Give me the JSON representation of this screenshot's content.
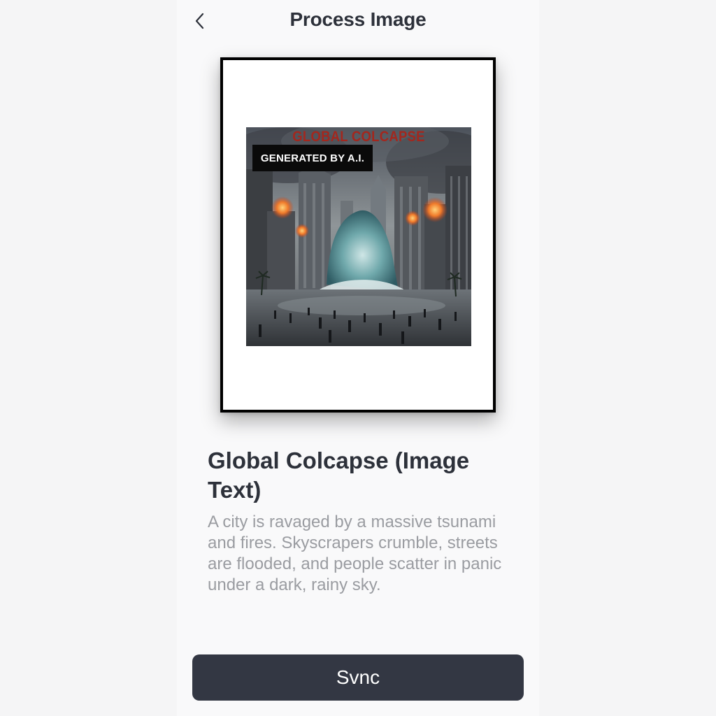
{
  "header": {
    "title": "Process Image",
    "back_icon": "chevron-left-icon"
  },
  "artwork": {
    "overlay_title": "GLOBAL COLCAPSE",
    "badge": "GENERATED BY A.I."
  },
  "item": {
    "title": "Global Colcapse (Image Text)",
    "description": "A city is ravaged by a massive tsunami and fires. Skyscrapers crumble, streets are flooded, and people scatter in panic under a dark, rainy sky."
  },
  "actions": {
    "primary_label": "Svnc"
  },
  "colors": {
    "primary_button": "#333743",
    "title_text": "#2d313a",
    "description_text": "#9a9ca1",
    "art_title": "#a3271e"
  }
}
